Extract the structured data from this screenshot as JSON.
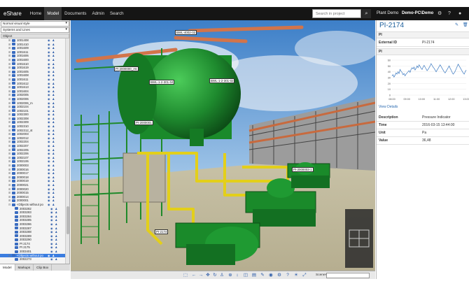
{
  "app": {
    "brand": "eShare"
  },
  "nav": {
    "tabs": [
      "Home",
      "Model",
      "Documents",
      "Admin",
      "Search"
    ],
    "active": "Model"
  },
  "search": {
    "placeholder": "Search in project"
  },
  "user": {
    "project": "Plant Demo",
    "machine": "Demo-PC\\Demo"
  },
  "left_panel": {
    "style_select": "Normal visual style",
    "systems_select": "Systems and Lines",
    "column_header": "Object",
    "tree_items": [
      "1001408",
      "1001410",
      "1001609",
      "1001611",
      "1001606",
      "1001600",
      "1001610",
      "1001619",
      "1001605",
      "1001608",
      "1001611",
      "1001612",
      "1001613",
      "1001604",
      "1002005",
      "1002006",
      "1002006_m",
      "1002104",
      "1002101",
      "1002300",
      "1002308",
      "1002309",
      "1002310",
      "1002312_st",
      "1002003",
      "1002012",
      "1002204",
      "1002207",
      "1002205",
      "1002206",
      "1002107",
      "1002106",
      "2000003",
      "2000016",
      "2000017",
      "2000018",
      "2000019",
      "2000021",
      "2000020",
      "2000015",
      "2000014",
      "2000001"
    ],
    "sub_group": "<Objects without position>",
    "sub_items": [
      "2003282",
      "2003283",
      "2003284",
      "2003285",
      "2003286",
      "2003287",
      "2003288",
      "2003289",
      "2003290",
      "PI 2174",
      "PI 2175",
      "2003401"
    ],
    "selected_item": "<Objects without position>",
    "tail_item": "2002273",
    "bottom_tabs": [
      "Model",
      "Markups",
      "Clip Box"
    ]
  },
  "viewport": {
    "tags": [
      "BWL-4002-02",
      "PI-2000000_A6",
      "BWL-1-2-301-04",
      "BWL-1-2-301-02",
      "PI-2000001",
      "PI-2000003-1",
      "PI-2174"
    ]
  },
  "bottom_toolbar": {
    "scenes_label": "Scenes"
  },
  "right_panel": {
    "title": "PI-2174",
    "section1": "PI",
    "external_id_label": "External ID",
    "external_id_value": "PI-2174",
    "section2": "PI",
    "view_details": "View Details",
    "rows": [
      {
        "k": "Description",
        "v": "Pressure Indicator"
      },
      {
        "k": "Time",
        "v": "2016-03-15 13:44:00"
      },
      {
        "k": "Unit",
        "v": "Pa"
      },
      {
        "k": "Value",
        "v": "36,48"
      }
    ]
  },
  "chart_data": {
    "type": "line",
    "x": [
      "08:00",
      "09:00",
      "10:00",
      "11:00",
      "12:00",
      "13:00"
    ],
    "ylabel": "",
    "ylim": [
      0,
      60
    ],
    "yticks": [
      0,
      10,
      20,
      30,
      40,
      50,
      60
    ],
    "series": [
      {
        "values": [
          33,
          35,
          31,
          34,
          38,
          36,
          40,
          37,
          44,
          41,
          39,
          35,
          37,
          33,
          36,
          38,
          40,
          42,
          39,
          44,
          47,
          45,
          48,
          43,
          46,
          50,
          47,
          52,
          49,
          46,
          44,
          48,
          51,
          48,
          45,
          42,
          44,
          47,
          50,
          54,
          51,
          48,
          46,
          43,
          40,
          43,
          46,
          49,
          52,
          49,
          46,
          43,
          40,
          38,
          41,
          44,
          47,
          50,
          46,
          43,
          39,
          36,
          38,
          41,
          45,
          49,
          53,
          50,
          47,
          44,
          41,
          38,
          36,
          40,
          43
        ]
      }
    ]
  }
}
